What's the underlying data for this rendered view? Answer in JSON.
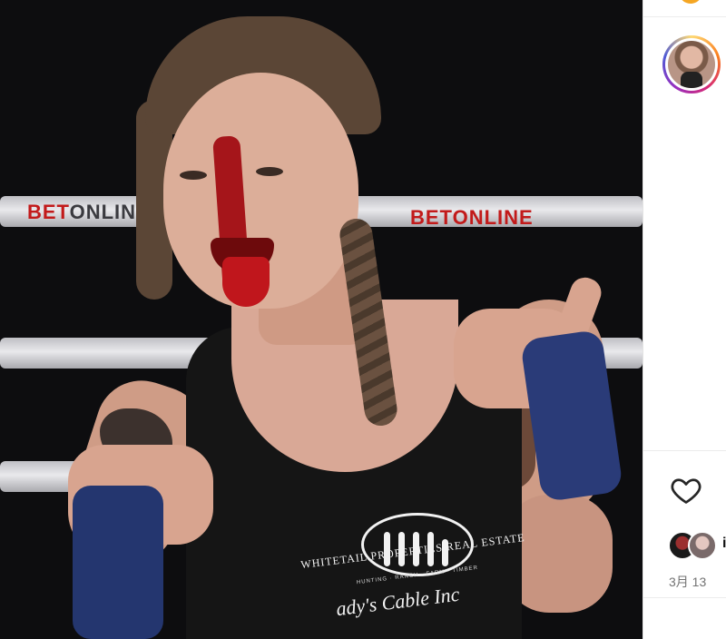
{
  "photo": {
    "rope_banner_brand": "BET",
    "rope_banner_brand_rest": "ONLINE",
    "rope_banner_brand_right": "BETONLINE",
    "shirt_sponsor": "WHITETAIL PROPERTIES REAL ESTATE",
    "shirt_sponsor_sub": "HUNTING · RANCH · FARM · TIMBER",
    "shirt_script": "ady's Cable Inc"
  },
  "sidebar": {
    "avatar_icon": "profile-avatar",
    "like_icon": "heart-outline-icon",
    "liker_more": "i",
    "date": "3月 13"
  },
  "colors": {
    "avatar_ring": [
      "#feda75",
      "#fa7e1e",
      "#d62976",
      "#962fbf",
      "#4f5bd5"
    ],
    "date_text": "#737373",
    "wraps": "#24366f",
    "blood": "#a5151a"
  }
}
